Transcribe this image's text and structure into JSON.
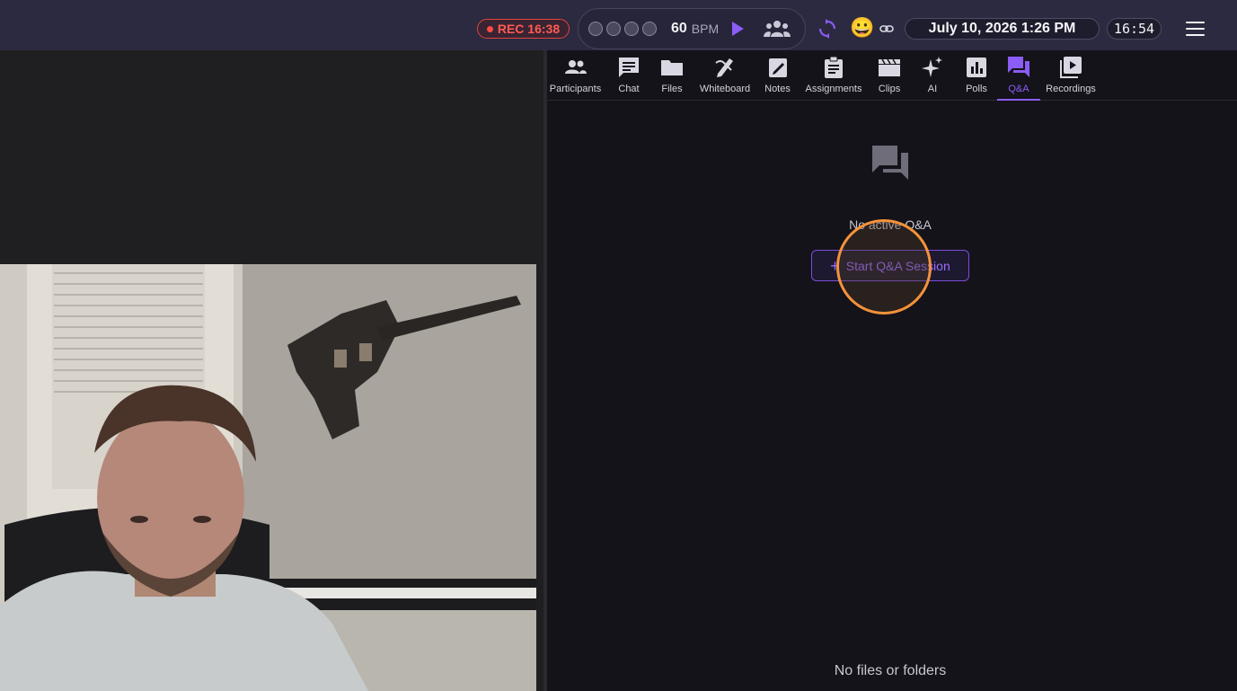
{
  "topbar": {
    "rec_label": "REC 16:38",
    "bpm_value": "60",
    "bpm_unit": "BPM",
    "emoji": "😀",
    "datetime": "July 10, 2026 1:26 PM",
    "timer": "16:54",
    "icons": [
      "play-icon",
      "group-icon",
      "sync-icon",
      "link-icon",
      "menu-icon"
    ],
    "accent_color": "#8b5cf6",
    "rec_color": "#ff4b43"
  },
  "tabs": [
    {
      "label": "Participants",
      "icon": "people-icon"
    },
    {
      "label": "Chat",
      "icon": "chat-icon"
    },
    {
      "label": "Files",
      "icon": "folder-icon"
    },
    {
      "label": "Whiteboard",
      "icon": "whiteboard-icon"
    },
    {
      "label": "Notes",
      "icon": "notes-icon"
    },
    {
      "label": "Assignments",
      "icon": "clipboard-icon"
    },
    {
      "label": "Clips",
      "icon": "clapper-icon"
    },
    {
      "label": "AI",
      "icon": "sparkle-icon"
    },
    {
      "label": "Polls",
      "icon": "poll-icon"
    },
    {
      "label": "Q&A",
      "icon": "qa-icon",
      "active": true
    },
    {
      "label": "Recordings",
      "icon": "recordings-icon"
    }
  ],
  "qa": {
    "empty_text": "No active Q&A",
    "start_button": "Start Q&A Session"
  },
  "footer": {
    "no_files": "No files or folders"
  }
}
